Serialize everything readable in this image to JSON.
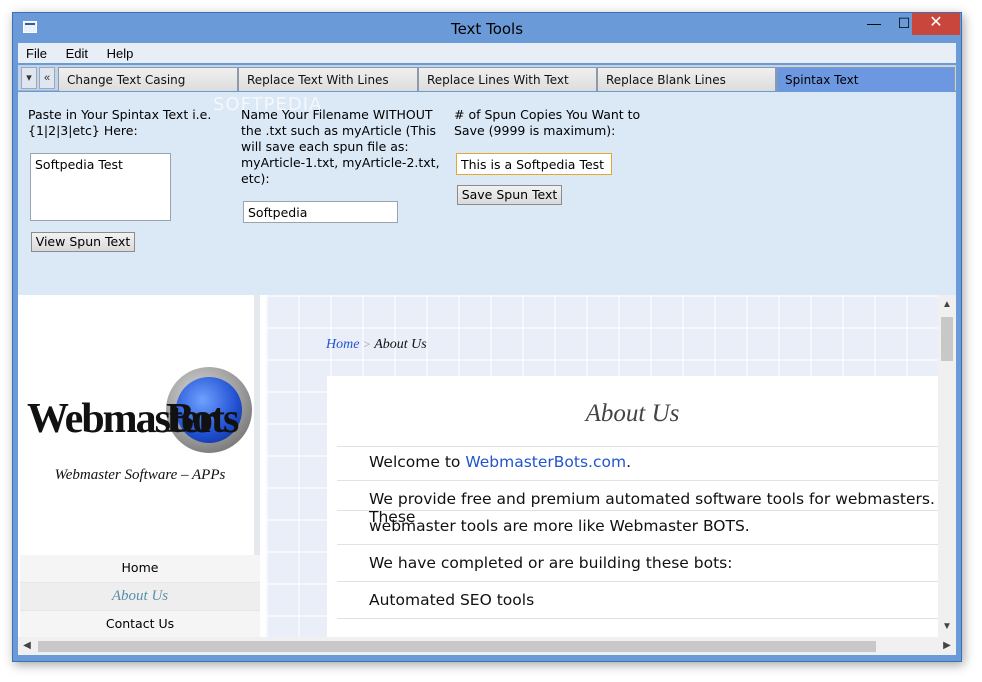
{
  "window": {
    "title": "Text Tools",
    "min_glyph": "—",
    "max_glyph": "☐",
    "close_glyph": "✕"
  },
  "menu": {
    "items": [
      "File",
      "Edit",
      "Help"
    ]
  },
  "tabs": {
    "nav_down": "▾",
    "nav_back": "«",
    "items": [
      {
        "label": "Change Text Casing",
        "active": false
      },
      {
        "label": "Replace Text With Lines",
        "active": false
      },
      {
        "label": "Replace Lines With Text",
        "active": false
      },
      {
        "label": "Replace Blank Lines",
        "active": false
      },
      {
        "label": "Spintax Text",
        "active": true
      }
    ]
  },
  "spintax": {
    "paste_label_1": "Paste in Your Spintax Text i.e.",
    "paste_label_2": "{1|2|3|etc} Here:",
    "spintax_value": "Softpedia Test",
    "view_button": "View Spun Text",
    "filename_label_1": "Name Your Filename WITHOUT",
    "filename_label_2": "the .txt such as myArticle (This",
    "filename_label_3": "will save each spun file as:",
    "filename_label_4": "myArticle-1.txt, myArticle-2.txt,",
    "filename_label_5": "etc):",
    "filename_value": "Softpedia",
    "copies_label_1": "# of Spun Copies You Want to",
    "copies_label_2": "Save (9999 is maximum):",
    "copies_value": "This is a Softpedia Test",
    "save_button": "Save Spun Text",
    "watermark": "SOFTPEDIA"
  },
  "site": {
    "logo_word_1": "Webmaster",
    "logo_word_2": "Bots",
    "tagline": "Webmaster Software – APPs",
    "nav": [
      {
        "label": "Home",
        "current": false
      },
      {
        "label": "About Us",
        "current": true
      },
      {
        "label": "Contact Us",
        "current": false
      }
    ],
    "breadcrumb_home": "Home",
    "breadcrumb_sep": ">",
    "breadcrumb_current": "About Us",
    "page_title": "About Us",
    "para_welcome_prefix": "Welcome to ",
    "para_welcome_link": "WebmasterBots.com",
    "para_welcome_suffix": ".",
    "para_provide_1": "We provide free and premium automated software tools for webmasters. These",
    "para_provide_2": "webmaster tools are more like Webmaster BOTS.",
    "para_completed": "We have completed or are building these bots:",
    "para_seo": "Automated SEO tools"
  },
  "scroll": {
    "up": "▲",
    "down": "▼",
    "left": "◀",
    "right": "▶"
  }
}
